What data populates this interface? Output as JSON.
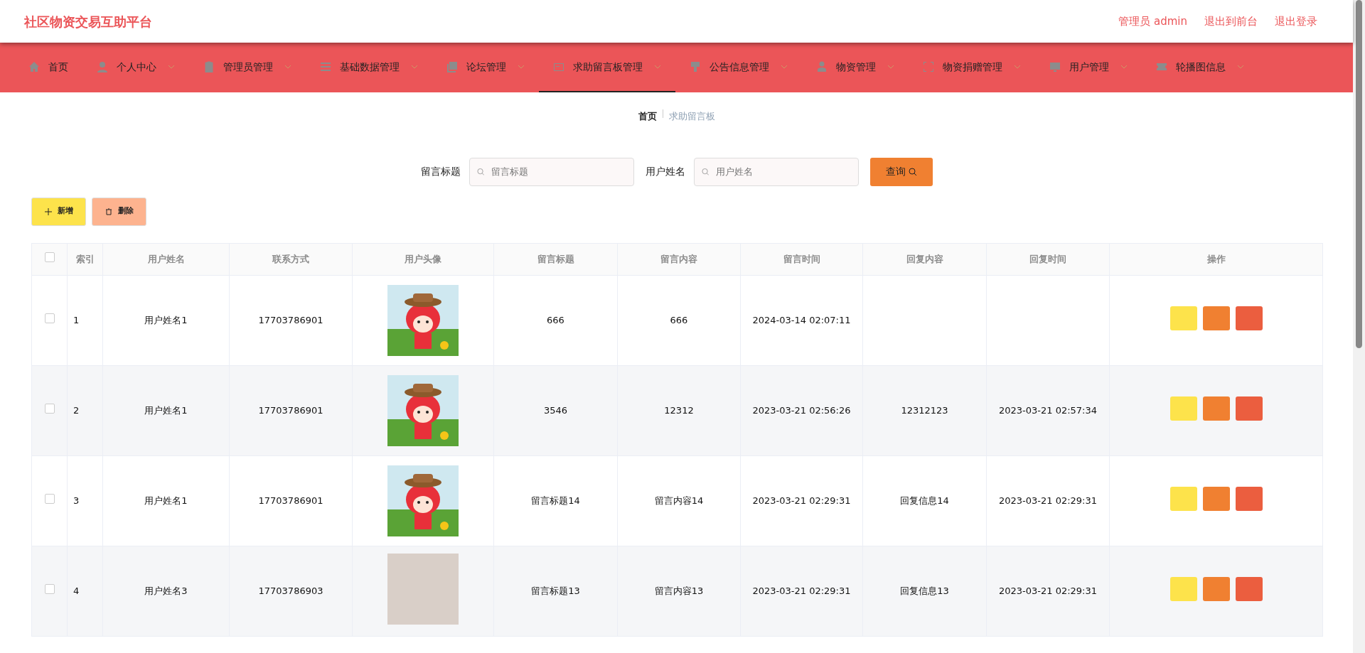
{
  "header": {
    "title": "社区物资交易互助平台",
    "links": [
      "管理员 admin",
      "退出到前台",
      "退出登录"
    ]
  },
  "nav": [
    {
      "label": "首页",
      "dropdown": false,
      "selected": false
    },
    {
      "label": "个人中心",
      "dropdown": true,
      "selected": false
    },
    {
      "label": "管理员管理",
      "dropdown": true,
      "selected": false
    },
    {
      "label": "基础数据管理",
      "dropdown": true,
      "selected": false
    },
    {
      "label": "论坛管理",
      "dropdown": true,
      "selected": false
    },
    {
      "label": "求助留言板管理",
      "dropdown": true,
      "selected": true
    },
    {
      "label": "公告信息管理",
      "dropdown": true,
      "selected": false
    },
    {
      "label": "物资管理",
      "dropdown": true,
      "selected": false
    },
    {
      "label": "物资捐赠管理",
      "dropdown": true,
      "selected": false
    },
    {
      "label": "用户管理",
      "dropdown": true,
      "selected": false
    },
    {
      "label": "轮播图信息",
      "dropdown": true,
      "selected": false
    }
  ],
  "breadcrumb": [
    {
      "label": "首页",
      "current": false
    },
    {
      "label": "求助留言板",
      "current": true
    }
  ],
  "search": {
    "fields": [
      {
        "label": "留言标题",
        "placeholder": "留言标题"
      },
      {
        "label": "用户姓名",
        "placeholder": "用户姓名"
      }
    ],
    "button": "查询"
  },
  "actions": [
    {
      "kind": "add",
      "label": "新增"
    },
    {
      "kind": "delete",
      "label": "删除"
    }
  ],
  "table": {
    "all_checked": false,
    "columns": [
      "索引",
      "用户姓名",
      "联系方式",
      "用户头像",
      "留言标题",
      "留言内容",
      "留言时间",
      "回复内容",
      "回复时间",
      "操作"
    ],
    "rows": [
      {
        "checked": false,
        "index": "1",
        "name": "用户姓名1",
        "phone": "17703786901",
        "kind": "cartoon",
        "title": "666",
        "content": "666",
        "time": "2024-03-14 02:07:11",
        "reply": "",
        "reply_time": ""
      },
      {
        "checked": false,
        "index": "2",
        "name": "用户姓名1",
        "phone": "17703786901",
        "kind": "cartoon",
        "title": "3546",
        "content": "12312",
        "time": "2023-03-21 02:56:26",
        "reply": "12312123",
        "reply_time": "2023-03-21 02:57:34"
      },
      {
        "checked": false,
        "index": "3",
        "name": "用户姓名1",
        "phone": "17703786901",
        "kind": "cartoon",
        "title": "留言标题14",
        "content": "留言内容14",
        "time": "2023-03-21 02:29:31",
        "reply": "回复信息14",
        "reply_time": "2023-03-21 02:29:31"
      },
      {
        "checked": false,
        "index": "4",
        "name": "用户姓名3",
        "phone": "17703786903",
        "kind": "photo",
        "title": "留言标题13",
        "content": "留言内容13",
        "time": "2023-03-21 02:29:31",
        "reply": "回复信息13",
        "reply_time": "2023-03-21 02:29:31"
      }
    ]
  }
}
